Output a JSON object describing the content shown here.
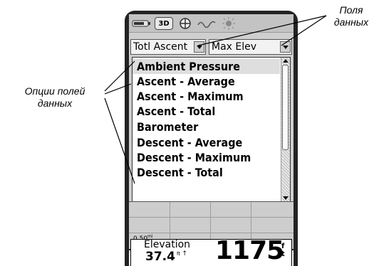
{
  "annotations": {
    "data_fields_callout": [
      "Поля",
      "данных"
    ],
    "options_callout": [
      "Опции полей",
      "данных"
    ]
  },
  "status_bar": {
    "gps_mode_label": "3D",
    "icons": [
      "battery-icon",
      "gps-3d-icon",
      "satellite-icon",
      "wave-icon",
      "backlight-sun-icon"
    ]
  },
  "data_fields": {
    "field_1": "Totl Ascent",
    "field_2": "Max Elev"
  },
  "options_list": {
    "items": [
      "Ambient Pressure",
      "Ascent - Average",
      "Ascent - Maximum",
      "Ascent - Total",
      "Barometer",
      "Descent - Average",
      "Descent - Maximum",
      "Descent - Total"
    ],
    "selected_index": 0
  },
  "plot": {
    "scale_label": "0.50",
    "scale_unit": "mi"
  },
  "elevation": {
    "label": "Elevation",
    "secondary_value": "37.4",
    "secondary_unit": "ft",
    "value": "1175",
    "unit_top": "f",
    "unit_bottom": "t"
  }
}
